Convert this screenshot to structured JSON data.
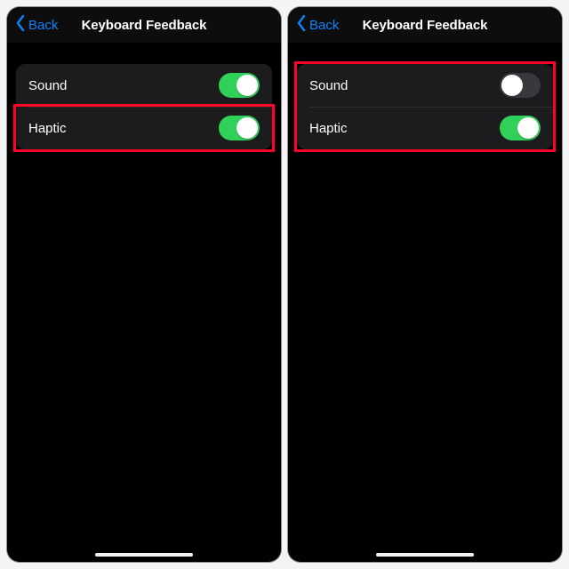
{
  "back_label": "Back",
  "page_title": "Keyboard Feedback",
  "colors": {
    "accent": "#0a84ff",
    "toggle_on": "#30d158",
    "toggle_off": "#39393d",
    "highlight": "#ff0026"
  },
  "left": {
    "rows": [
      {
        "label": "Sound",
        "on": true
      },
      {
        "label": "Haptic",
        "on": true
      }
    ],
    "highlight_row_index": 1
  },
  "right": {
    "rows": [
      {
        "label": "Sound",
        "on": false
      },
      {
        "label": "Haptic",
        "on": true
      }
    ],
    "highlight_group": true
  }
}
